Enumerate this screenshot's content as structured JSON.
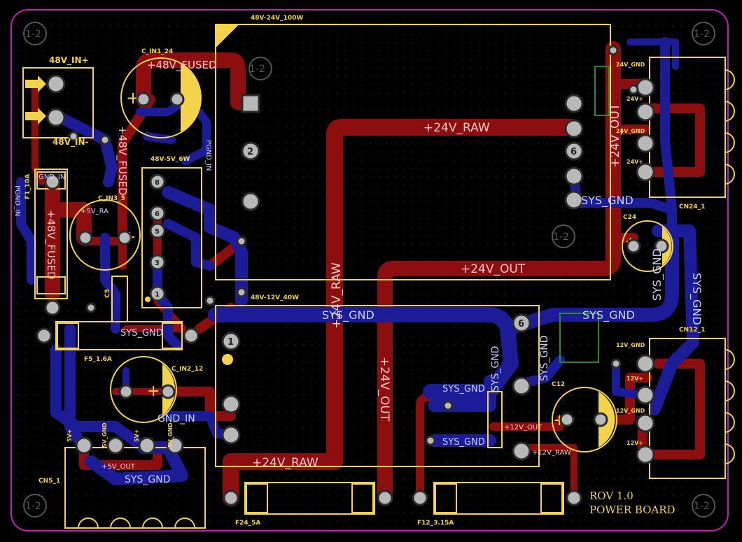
{
  "board": {
    "title_line1": "ROV 1.0",
    "title_line2": "POWER BOARD",
    "mount_label": "1-2",
    "colors": {
      "background": "#000000",
      "outline": "#c21fb8",
      "silkscreen": "#f2d34a",
      "top_copper": "#8c0e0e",
      "bottom_copper": "#1c1c98",
      "pad": "#b8b8b8"
    }
  },
  "components": {
    "conv_24": "48V-24V_100W",
    "conv_5": "48V-5V_6W",
    "conv_12": "48V-12V_40W",
    "in_conn_pos": "48V_IN+",
    "in_conn_neg": "48V_IN-",
    "c_in1": "C_IN1_24",
    "c_in3": "C_IN3_5",
    "c_in2": "C_IN2_12",
    "c24": "C24",
    "c12": "C12",
    "c5": "C5",
    "f1": "F1_10A",
    "f5": "F5_1.6A",
    "f24": "F24_5A",
    "f12": "F12_3.15A",
    "cn24": "CN24_1",
    "cn12": "CN12_1",
    "cn5": "CN5_1"
  },
  "pins": {
    "cn24": [
      "24V_GND",
      "24V+",
      "24V_GND",
      "24V+"
    ],
    "cn12": [
      "12V_GND",
      "12V+",
      "12V_GND",
      "12V+"
    ],
    "cn5": [
      "5V+",
      "5V_GND",
      "5V+",
      "5V_GND"
    ],
    "conv24_pad_numbers": [
      "2",
      "6"
    ],
    "conv5_pad_numbers": [
      "8",
      "6",
      "5",
      "3",
      "1"
    ],
    "conv12_pad_numbers": [
      "6",
      "1"
    ]
  },
  "nets": {
    "v24_raw": "+24V_RAW",
    "v24_out": "+24V_OUT",
    "v48_fused": "+48V_FUSED",
    "v5_out": "+5V_OUT",
    "v12_out": "+12V_OUT",
    "v12_raw": "+12V_RAW",
    "sys_gnd": "SYS_GND",
    "pgnd_in": "PGND_IN",
    "gnd_in": "GND_IN",
    "v5_raw": "+5V_RA"
  }
}
